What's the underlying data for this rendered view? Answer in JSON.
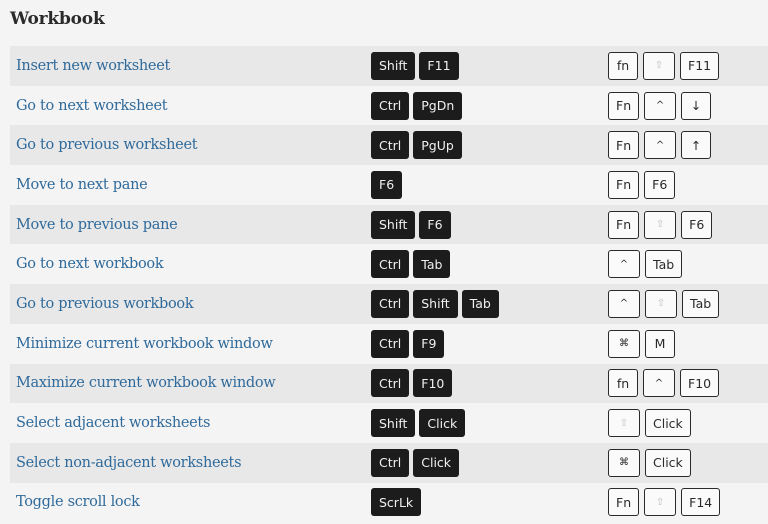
{
  "section_title": "Workbook",
  "rows": [
    {
      "action": "Insert new worksheet",
      "windows": [
        "Shift",
        "F11"
      ],
      "mac": [
        "fn",
        "⇧",
        "F11"
      ]
    },
    {
      "action": "Go to next worksheet",
      "windows": [
        "Ctrl",
        "PgDn"
      ],
      "mac": [
        "Fn",
        "^",
        "↓"
      ]
    },
    {
      "action": "Go to previous worksheet",
      "windows": [
        "Ctrl",
        "PgUp"
      ],
      "mac": [
        "Fn",
        "^",
        "↑"
      ]
    },
    {
      "action": "Move to next pane",
      "windows": [
        "F6"
      ],
      "mac": [
        "Fn",
        "F6"
      ]
    },
    {
      "action": "Move to previous pane",
      "windows": [
        "Shift",
        "F6"
      ],
      "mac": [
        "Fn",
        "⇧",
        "F6"
      ]
    },
    {
      "action": "Go to next workbook",
      "windows": [
        "Ctrl",
        "Tab"
      ],
      "mac": [
        "^",
        "Tab"
      ]
    },
    {
      "action": "Go to previous workbook",
      "windows": [
        "Ctrl",
        "Shift",
        "Tab"
      ],
      "mac": [
        "^",
        "⇧",
        "Tab"
      ]
    },
    {
      "action": "Minimize current workbook window",
      "windows": [
        "Ctrl",
        "F9"
      ],
      "mac": [
        "⌘",
        "M"
      ]
    },
    {
      "action": "Maximize current workbook window",
      "windows": [
        "Ctrl",
        "F10"
      ],
      "mac": [
        "fn",
        "^",
        "F10"
      ]
    },
    {
      "action": "Select adjacent worksheets",
      "windows": [
        "Shift",
        "Click"
      ],
      "mac": [
        "⇧",
        "Click"
      ]
    },
    {
      "action": "Select non-adjacent worksheets",
      "windows": [
        "Ctrl",
        "Click"
      ],
      "mac": [
        "⌘",
        "Click"
      ]
    },
    {
      "action": "Toggle scroll lock",
      "windows": [
        "ScrLk"
      ],
      "mac": [
        "Fn",
        "⇧",
        "F14"
      ]
    }
  ],
  "colors": {
    "link": "#2f6a9b",
    "row_odd": "#e8e8e8",
    "row_even": "#f4f4f4",
    "key_dark": "#1c1c1c",
    "key_light_border": "#2a2a2a"
  }
}
